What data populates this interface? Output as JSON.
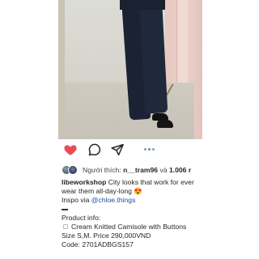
{
  "post": {
    "actions": {
      "like_icon": "heart-filled",
      "like_color": "#ed4956",
      "comment_icon": "comment-bubble",
      "share_icon": "paper-plane",
      "carousel_dots": 3,
      "carousel_active": 2
    },
    "likes": {
      "prefix": "Người thích:",
      "user": "n__tram96",
      "connector": "và",
      "count": "1.006 r"
    },
    "caption": {
      "username": "libeworkshop",
      "line1": " City looks that work for ever wear them all-day-long 😍",
      "inspo_prefix": "Inspo via ",
      "inspo_handle": "@chloe.things",
      "product_info": "Product info:",
      "item_name": "Cream Knitted Camisole with Buttons",
      "size_price": "Size S,M. Price 290,000VND",
      "code": "Code: 2701ADBGS157"
    }
  }
}
